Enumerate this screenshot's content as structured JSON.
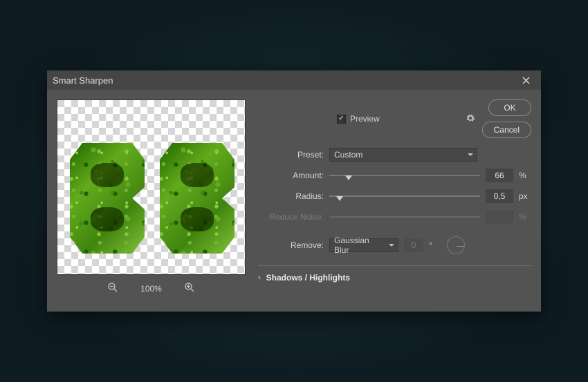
{
  "dialog": {
    "title": "Smart Sharpen"
  },
  "buttons": {
    "ok": "OK",
    "cancel": "Cancel"
  },
  "preview": {
    "checkbox_label": "Preview",
    "checked": true
  },
  "preset": {
    "label": "Preset:",
    "value": "Custom"
  },
  "amount": {
    "label": "Amount:",
    "value": "66",
    "unit": "%",
    "pos": 13
  },
  "radius": {
    "label": "Radius:",
    "value": "0,5",
    "unit": "px",
    "pos": 7
  },
  "reduce_noise": {
    "label": "Reduce Noise:",
    "value": "",
    "unit": "%",
    "pos": 0
  },
  "remove": {
    "label": "Remove:",
    "value": "Gaussian Blur",
    "angle_value": "0",
    "angle_unit": "°"
  },
  "section": {
    "label": "Shadows / Highlights"
  },
  "zoom": {
    "level": "100%"
  }
}
